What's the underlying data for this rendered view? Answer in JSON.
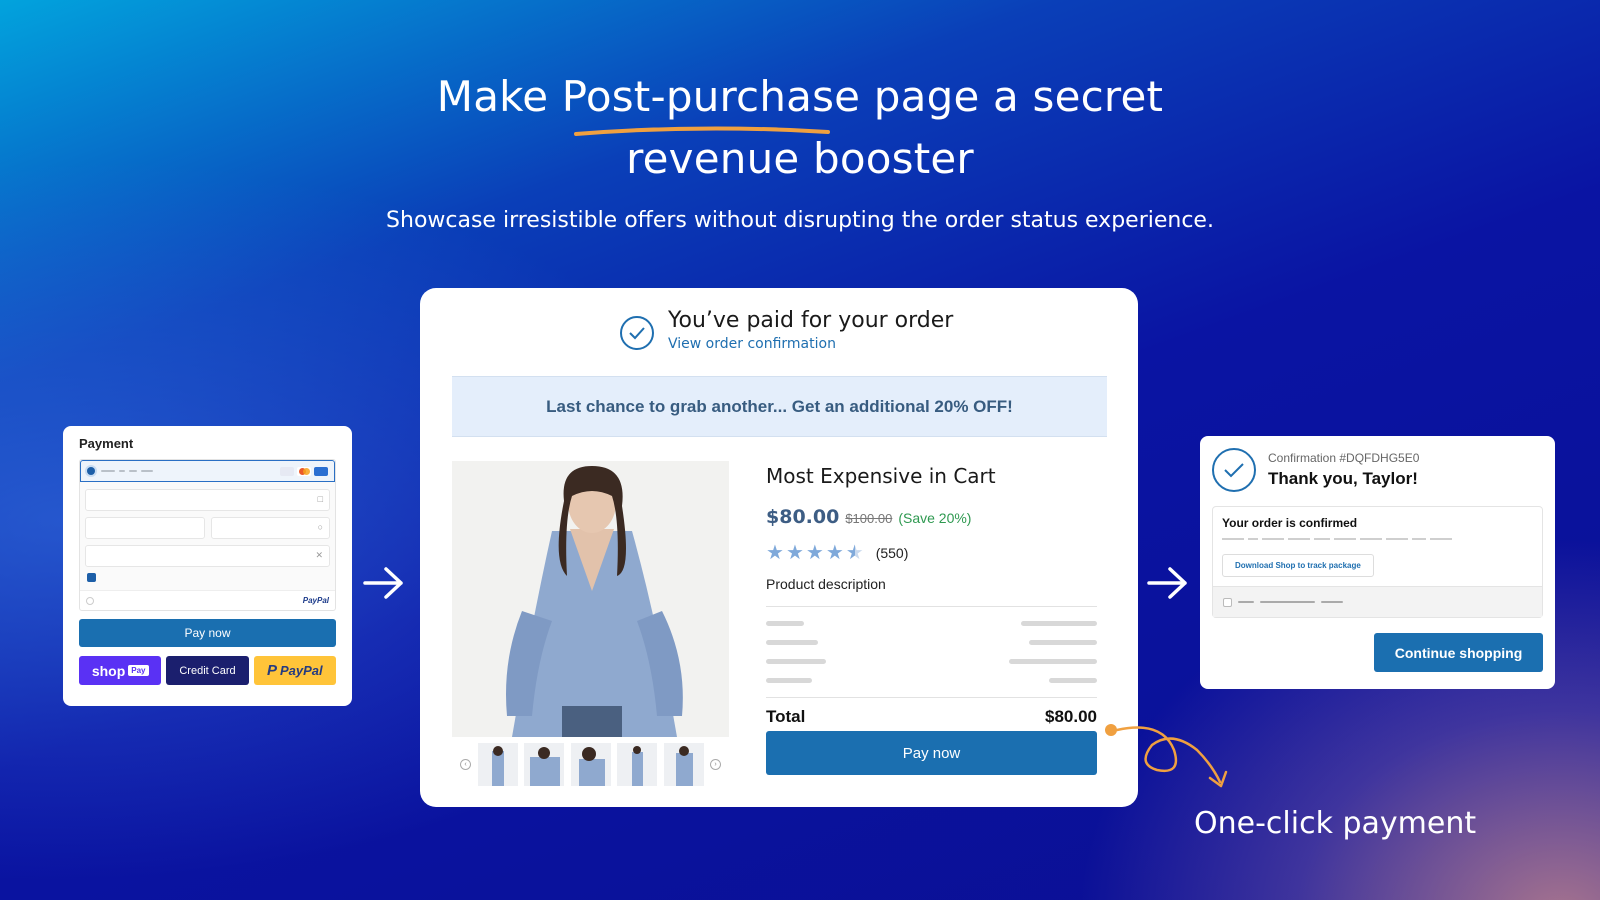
{
  "hero": {
    "title_line1_pre": "Make ",
    "title_line1_highlight": "Post-purchase",
    "title_line1_post": " page a secret",
    "title_line2": "revenue booster",
    "subtitle": "Showcase irresistible offers without disrupting the order status experience."
  },
  "payment": {
    "title": "Payment",
    "pay_button": "Pay now",
    "methods": {
      "shop": "shop",
      "shop_badge": "Pay",
      "credit_card": "Credit Card",
      "paypal": "PayPal"
    },
    "paypal_mini": "PayPal",
    "card_colors": [
      "#e6e9f3",
      "#eb5a2b",
      "#2b6fd1"
    ]
  },
  "order": {
    "paid_title": "You’ve paid for your order",
    "paid_link": "View order confirmation",
    "offer_banner": "Last chance to grab another... Get an additional 20% OFF!",
    "product": {
      "name": "Most Expensive in Cart",
      "price": "$80.00",
      "old_price": "$100.00",
      "save": "(Save 20%)",
      "rating": 4.5,
      "reviews": "(550)",
      "description": "Product description"
    },
    "total_label": "Total",
    "total_value": "$80.00",
    "pay_button": "Pay now"
  },
  "confirmation": {
    "number": "Confirmation #DQFDHG5E0",
    "thanks": "Thank you, Taylor!",
    "box_title": "Your order is confirmed",
    "download_button": "Download Shop to track package",
    "continue_button": "Continue shopping"
  },
  "callout": {
    "label": "One-click payment"
  },
  "colors": {
    "accent": "#1b6fb0",
    "curl": "#f0a040",
    "underline": "#f0a040"
  }
}
